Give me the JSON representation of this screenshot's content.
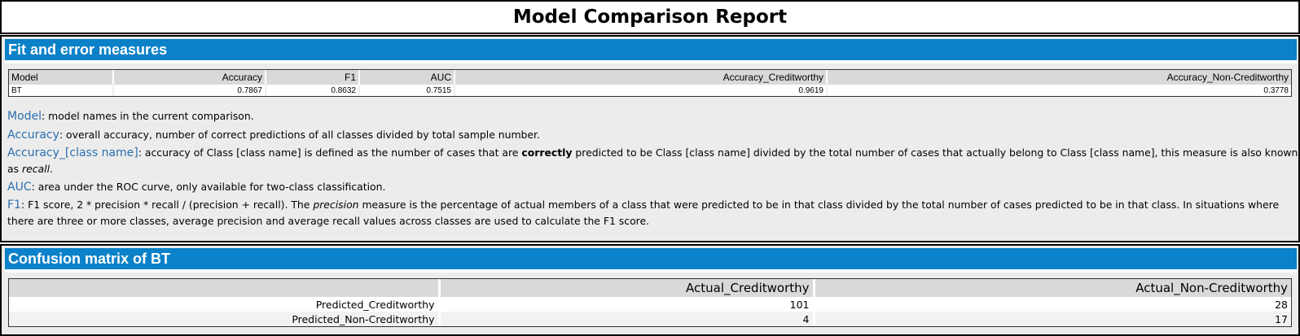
{
  "report": {
    "title": "Model Comparison Report"
  },
  "fit_section": {
    "header": "Fit and error measures",
    "columns": [
      "Model",
      "Accuracy",
      "F1",
      "AUC",
      "Accuracy_Creditworthy",
      "Accuracy_Non-Creditworthy"
    ],
    "rows": [
      [
        "BT",
        "0.7867",
        "0.8632",
        "0.7515",
        "0.9619",
        "0.3778"
      ]
    ],
    "glossary": {
      "model_term": "Model",
      "model_desc": ": model names in the current comparison.",
      "accuracy_term": "Accuracy",
      "accuracy_desc": ": overall accuracy, number of correct predictions of all classes divided by total sample number.",
      "class_term": "Accuracy_[class name]",
      "class_desc_1": ": accuracy of Class [class name] is defined as the number of cases that are ",
      "class_desc_bold": "correctly",
      "class_desc_2": " predicted to be Class [class name] divided by the total number of cases that actually belong to Class [class name], this measure is also known as ",
      "class_desc_italic": "recall",
      "class_desc_3": ".",
      "auc_term": "AUC",
      "auc_desc": ": area under the ROC curve, only available for two-class classification.",
      "f1_term": "F1",
      "f1_desc_1": ": F1 score, 2 * precision * recall / (precision + recall). The ",
      "f1_desc_italic": "precision",
      "f1_desc_2": " measure is the percentage of actual members of a class that were predicted to be in that class divided by the total number of cases predicted to be in that class. In situations where there are three or more classes, average precision and average recall values across classes are used to calculate the F1 score."
    }
  },
  "confusion_section": {
    "header": "Confusion matrix of BT",
    "columns": [
      "",
      "Actual_Creditworthy",
      "Actual_Non-Creditworthy"
    ],
    "rows": [
      [
        "Predicted_Creditworthy",
        "101",
        "28"
      ],
      [
        "Predicted_Non-Creditworthy",
        "4",
        "17"
      ]
    ]
  }
}
